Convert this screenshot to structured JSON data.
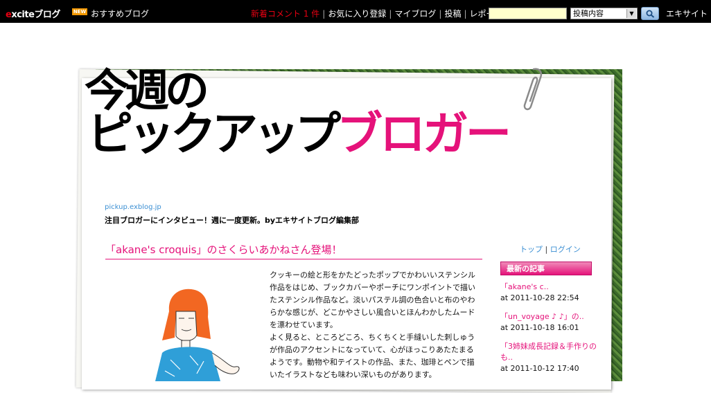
{
  "topbar": {
    "logo_e": "e",
    "logo_rest": "xciteブログ",
    "new_badge": "NEW",
    "recommend": "おすすめブログ",
    "new_comment": "新着コメント 1 件",
    "nav": [
      "お気に入り登録",
      "マイブログ",
      "投稿",
      "レポート"
    ],
    "search_value": "",
    "select_value": "投稿内容",
    "brand": "エキサイト"
  },
  "header": {
    "line1": "今週の",
    "line2_black": "ピックアップ",
    "line2_pink": "ブロガー"
  },
  "blog": {
    "url": "pickup.exblog.jp",
    "description": "注目ブロガーにインタビュー！週に一度更新。byエキサイトブログ編集部"
  },
  "post": {
    "title": "「akane's croquis」のさくらいあかねさん登場！",
    "paragraph1": "クッキーの絵と形をかたどったポップでかわいいステンシル作品をはじめ、ブックカバーやポーチにワンポイントで描いたステンシル作品など。淡いパステル調の色合いと布のやわらかな感じが、どこかやさしい風合いとほんわかしたムードを漂わせています。",
    "paragraph2": "よく見ると、ところどころ、ちくちくと手縫いした刺しゅうが作品のアクセントになっていて、心がほっこりあたたまるようです。動物や和テイストの作品、また、珈琲とペンで描いたイラストなども味わい深いものがあります。"
  },
  "sidebar": {
    "top_link": "トップ",
    "login_link": "ログイン",
    "header": "最新の記事",
    "items": [
      {
        "title": "「akane's c..",
        "date": "at 2011-10-28 22:54"
      },
      {
        "title": "「un_voyage ♪ ♪」の..",
        "date": "at 2011-10-18 16:01"
      },
      {
        "title": "「3姉妹成長記録＆手作りのも..",
        "date": "at 2011-10-12 17:40"
      }
    ]
  }
}
